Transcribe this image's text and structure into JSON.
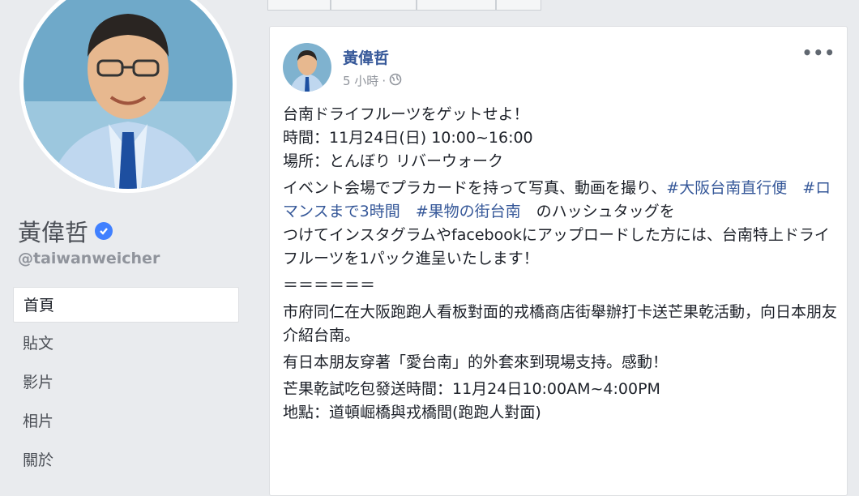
{
  "profile": {
    "name": "黃偉哲",
    "handle": "@taiwanweicher"
  },
  "nav": {
    "items": [
      {
        "label": "首頁",
        "active": true
      },
      {
        "label": "貼文",
        "active": false
      },
      {
        "label": "影片",
        "active": false
      },
      {
        "label": "相片",
        "active": false
      },
      {
        "label": "關於",
        "active": false
      }
    ]
  },
  "post": {
    "author": "黃偉哲",
    "time": "5 小時",
    "separator": "·",
    "privacy_icon": "globe-icon",
    "more_label": "•••",
    "lines": {
      "l1": "台南ドライフルーツをゲットせよ！",
      "l2": "時間：11月24日(日) 10:00~16:00",
      "l3": "場所：とんぼり リバーウォーク",
      "l4a": "イベント会場でプラカードを持って写真、動画を撮り、",
      "tag1": "#大阪台南直行便",
      "tag2": "#ロマンスまで3時間",
      "tag3": "#果物の街台南",
      "l4b": "のハッシュタッグを",
      "l5": "つけてインスタグラムやfacebookにアップロードした方には、台南特上ドライフルーツを1パック進呈いたします！",
      "l6": "＝＝＝＝＝＝",
      "l7": "市府同仁在大阪跑跑人看板對面的戎橋商店街舉辦打卡送芒果乾活動，向日本朋友介紹台南。",
      "l8": "有日本朋友穿著「愛台南」的外套來到現場支持。感動！",
      "l9": "芒果乾試吃包發送時間：11月24日10:00AM~4:00PM",
      "l10": "地點：道頓崛橋與戎橋間(跑跑人對面)"
    }
  },
  "colors": {
    "page_bg": "#e9ebee",
    "link": "#365899",
    "verified": "#4080ff"
  }
}
